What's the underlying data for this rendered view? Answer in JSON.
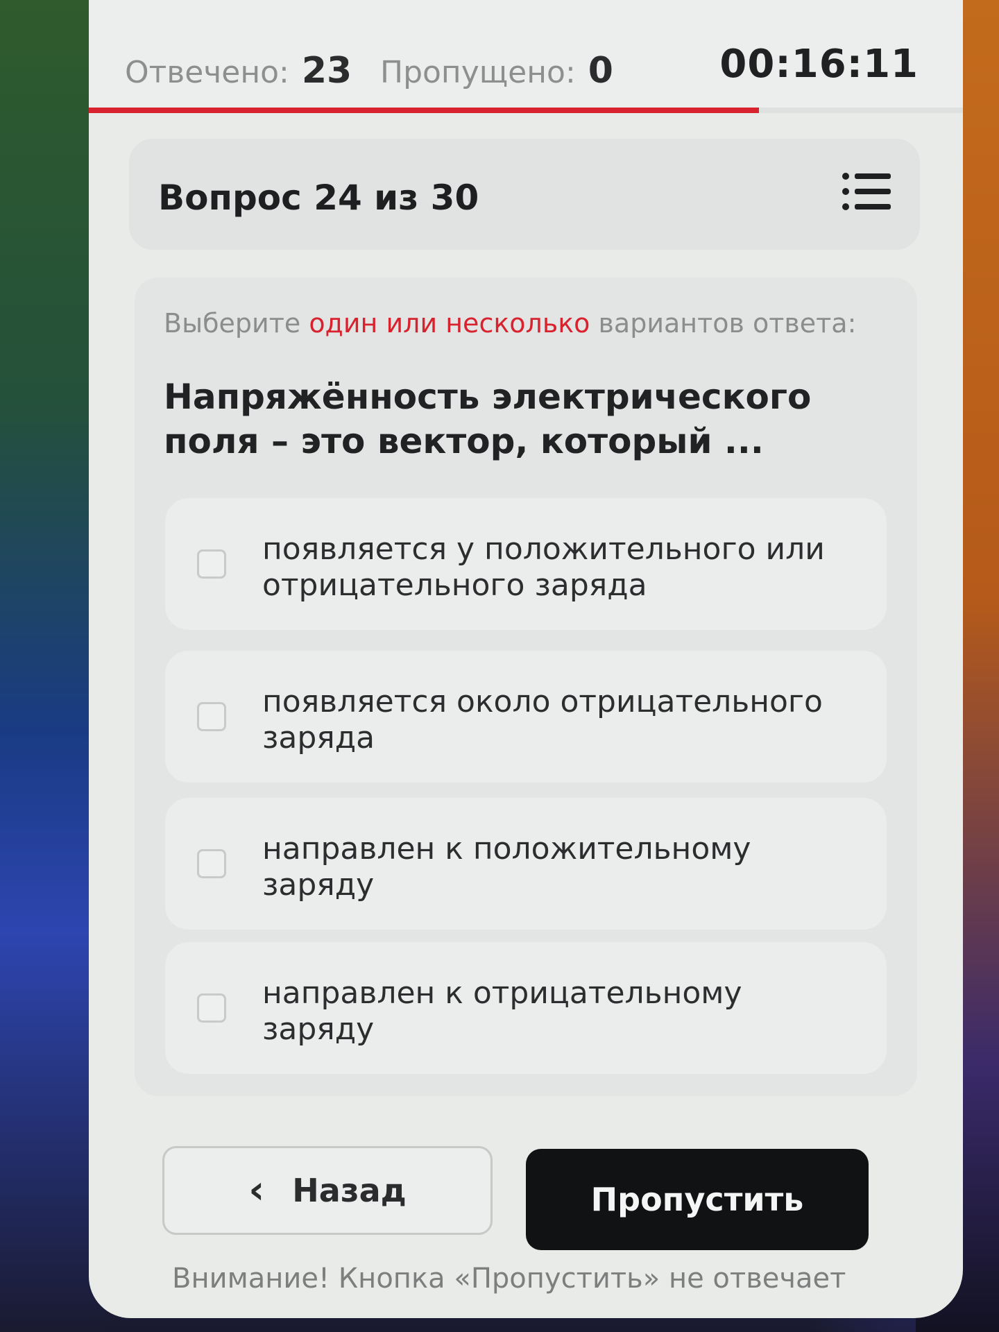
{
  "stats": {
    "answered_label": "Отвечено:",
    "answered_value": "23",
    "skipped_label": "Пропущено:",
    "skipped_value": "0",
    "timer": "00:16:11",
    "progress_fraction": 0.767
  },
  "question": {
    "counter": "Вопрос 24 из 30",
    "instruction_prefix": "Выберите",
    "instruction_accent": "один или несколько",
    "instruction_suffix": "вариантов ответа:",
    "text": "Напряжённость электрического поля – это вектор, который ..."
  },
  "options": [
    {
      "label": "появляется у положительного или отрицательного заряда",
      "checked": false
    },
    {
      "label": "появляется около отрицательного заряда",
      "checked": false
    },
    {
      "label": "направлен к положительному заряду",
      "checked": false
    },
    {
      "label": "направлен к отрицательному заряду",
      "checked": false
    }
  ],
  "actions": {
    "back_label": "Назад",
    "skip_label": "Пропустить"
  },
  "footer": {
    "warning": "Внимание! Кнопка «Пропустить» не отвечает"
  },
  "colors": {
    "accent": "#d8232e",
    "primary_button": "#111213"
  },
  "icons": {
    "list": "list-icon",
    "back": "chevron-left-icon"
  }
}
